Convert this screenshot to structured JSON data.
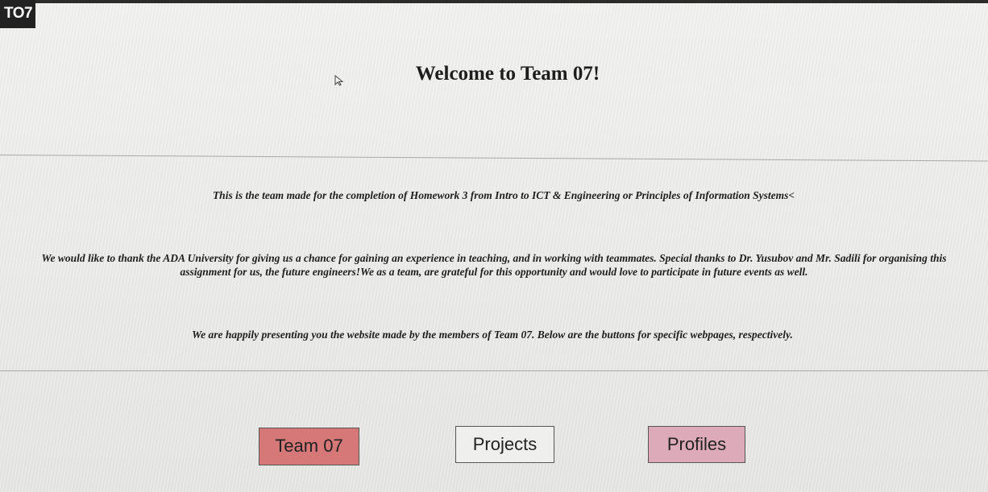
{
  "header": {
    "logo_text": "TO7"
  },
  "main": {
    "title": "Welcome to Team 07!",
    "paragraph_1": "This is the team made for the completion of Homework 3 from Intro to ICT & Engineering or Principles of Information Systems<",
    "paragraph_2": "We would like to thank the ADA University for giving us a chance for gaining an experience in teaching, and in working with teammates. Special thanks to Dr. Yusubov and Mr. Sadili for organising this assignment for us, the future engineers!We as a team, are grateful for this opportunity and would love to participate in future events as well.",
    "paragraph_3": "We are happily presenting you the website made by the members of Team 07. Below are the buttons for specific webpages, respectively."
  },
  "buttons": {
    "team_label": "Team 07",
    "projects_label": "Projects",
    "profiles_label": "Profiles"
  },
  "colors": {
    "team_button": "#d77878",
    "projects_button": "#efefed",
    "profiles_button": "#dcaab9",
    "logo_background": "#222222"
  },
  "icons": {
    "cursor": "mouse-cursor-icon"
  }
}
